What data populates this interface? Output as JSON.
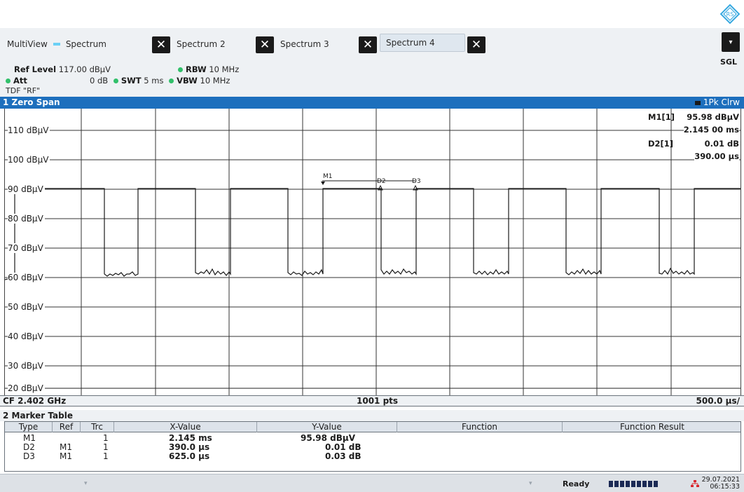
{
  "tabs": {
    "multiview": "MultiView",
    "spectrum": "Spectrum",
    "spectrum2": "Spectrum 2",
    "spectrum3": "Spectrum 3",
    "spectrum4": "Spectrum 4"
  },
  "params": {
    "ref_level_label": "Ref Level",
    "ref_level_value": "117.00 dBµV",
    "att_label": "Att",
    "att_value": "0 dB",
    "swt_label": "SWT",
    "swt_value": "5 ms",
    "rbw_label": "RBW",
    "rbw_value": "10 MHz",
    "vbw_label": "VBW",
    "vbw_value": "10 MHz",
    "tdf": "TDF \"RF\""
  },
  "sgl_label": "SGL",
  "diagram": {
    "title": "1 Zero Span",
    "trace": "1Pk Clrw",
    "y_labels": [
      "110 dBµV",
      "100 dBµV",
      "90 dBµV",
      "80 dBµV",
      "70 dBµV",
      "60 dBµV",
      "50 dBµV",
      "40 dBµV",
      "30 dBµV",
      "20 dBµV"
    ],
    "markers_info": {
      "m1_label": "M1[1]",
      "m1_y": "95.98 dBµV",
      "m1_x": "2.145 00 ms",
      "d2_label": "D2[1]",
      "d2_y": "0.01 dB",
      "d2_x": "390.00 µs"
    },
    "marker_tags": [
      "M1",
      "D2",
      "D3"
    ],
    "cf": "CF 2.402 GHz",
    "pts": "1001 pts",
    "div": "500.0 µs/"
  },
  "marker_table": {
    "title": "2 Marker Table",
    "headers": [
      "Type",
      "Ref",
      "Trc",
      "X-Value",
      "Y-Value",
      "Function",
      "Function Result"
    ],
    "rows": [
      {
        "type": "M1",
        "ref": "",
        "trc": "1",
        "x": "2.145 ms",
        "y": "95.98 dBµV"
      },
      {
        "type": "D2",
        "ref": "M1",
        "trc": "1",
        "x": "390.0 µs",
        "y": "0.01 dB"
      },
      {
        "type": "D3",
        "ref": "M1",
        "trc": "1",
        "x": "625.0 µs",
        "y": "0.03 dB"
      }
    ]
  },
  "status": {
    "ready": "Ready",
    "date": "29.07.2021",
    "time": "06:15:33"
  },
  "colors": {
    "title_bar": "#1d6fbd",
    "led": "#31c06a",
    "tab_indicator": "#6ad0f5"
  }
}
